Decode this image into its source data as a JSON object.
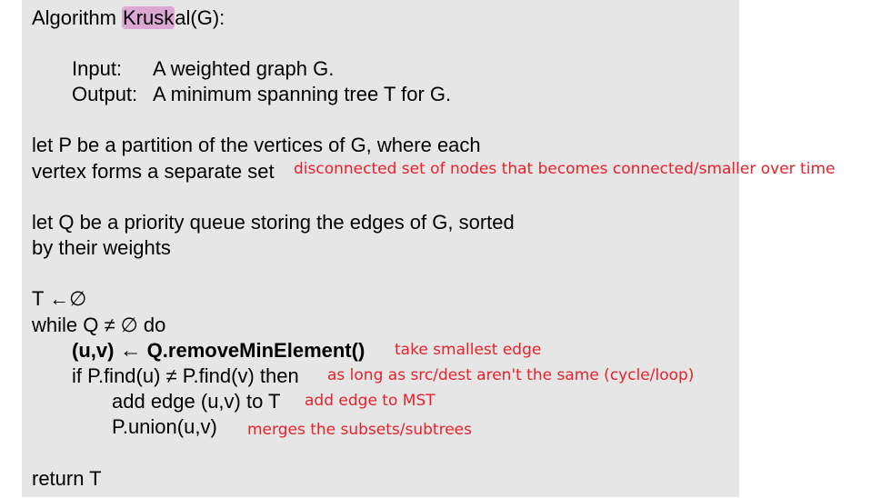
{
  "algorithm": {
    "header_prefix": "Algorithm ",
    "header_highlight": "Krusk",
    "header_suffix": "al(G):",
    "input_label": "Input:",
    "input_text": "A weighted graph G.",
    "output_label": "Output:",
    "output_text": "A minimum spanning tree T for G.",
    "line_partition_1": "let P be a partition of the vertices of G, where each",
    "line_partition_2": "vertex forms a separate set",
    "line_queue_1": "let Q be a priority queue storing the edges of G, sorted",
    "line_queue_2": "by their weights",
    "line_t_init": "T ←∅",
    "line_while": "while Q ≠ ∅ do",
    "line_remove_a": "(u,v) ",
    "line_remove_arrow": "←",
    "line_remove_b": " Q.removeMinElement()",
    "line_if": "if P.find(u) ≠ P.find(v) then",
    "line_add": "add edge (u,v) to T",
    "line_union": "P.union(u,v)",
    "line_return": "return T"
  },
  "annotations": {
    "partition_note": "disconnected set of nodes that becomes connected/smaller over time",
    "remove_note": "take smallest edge",
    "if_note": "as long as src/dest aren't the same (cycle/loop)",
    "add_note": "add edge to MST",
    "union_note": "merges the subsets/subtrees"
  },
  "colors": {
    "panel_bg": "#e6e6e6",
    "annotation": "#e8212b",
    "highlight": "#dba8d4"
  }
}
